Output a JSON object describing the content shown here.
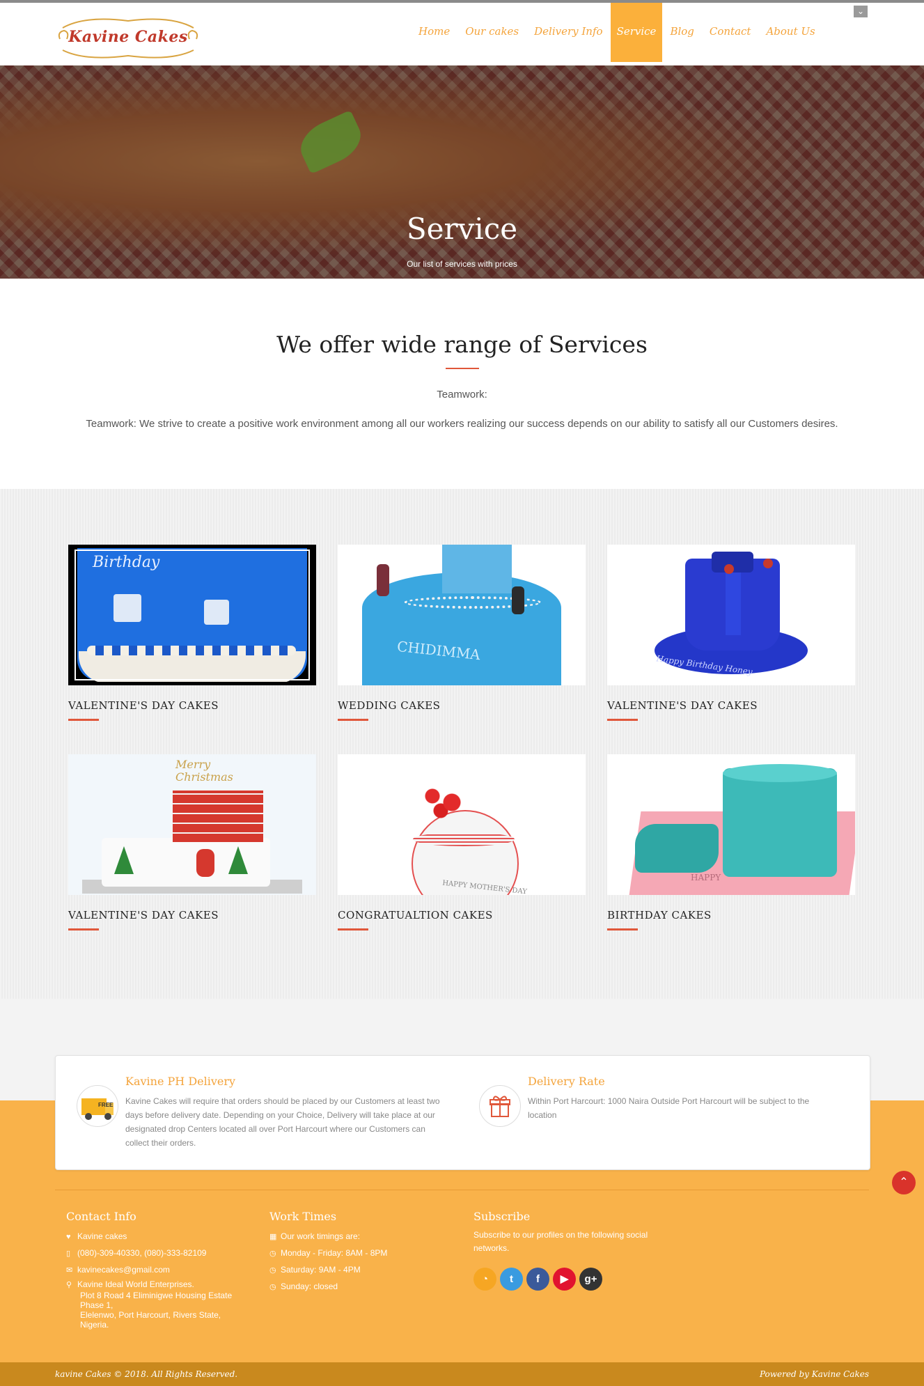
{
  "brand": {
    "logo_text": "Kavine Cakes"
  },
  "nav": {
    "items": [
      {
        "label": "Home"
      },
      {
        "label": "Our cakes"
      },
      {
        "label": "Delivery Info"
      },
      {
        "label": "Service"
      },
      {
        "label": "Blog"
      },
      {
        "label": "Contact"
      },
      {
        "label": "About Us"
      }
    ],
    "active": "Service"
  },
  "hero": {
    "title": "Service",
    "subtitle": "Our list of services with prices"
  },
  "intro": {
    "title": "We offer wide range of Services",
    "label": "Teamwork:",
    "text": "Teamwork: We strive to create a positive work environment among all our workers realizing our success depends on our ability to satisfy all our Customers desires."
  },
  "services": [
    {
      "caption": "Valentine's Day Cakes",
      "image_text": "Birthday"
    },
    {
      "caption": "Wedding Cakes",
      "image_text": "CHIDIMMA"
    },
    {
      "caption": "Valentine's Day Cakes",
      "image_text": "Happy Birthday Honey"
    },
    {
      "caption": "Valentine's Day Cakes",
      "image_text": "Merry Christmas"
    },
    {
      "caption": "CONGRATUALTION CAKES",
      "image_text": "HAPPY MOTHER'S DAY"
    },
    {
      "caption": "Birthday Cakes",
      "image_text": "HAPPY"
    }
  ],
  "info": {
    "delivery": {
      "title": "Kavine PH Delivery",
      "text": "Kavine Cakes will require that orders should be placed by our Customers at least two days before delivery date. Depending on your Choice, Delivery will take place at our designated drop Centers located all over Port Harcourt where our Customers can collect their orders.",
      "icon_label": "FREE"
    },
    "rate": {
      "title": "Delivery Rate",
      "text": "Within Port Harcourt: 1000 Naira Outside Port Harcourt will be subject to the location"
    }
  },
  "footer": {
    "contact": {
      "title": "Contact Info",
      "name": "Kavine cakes",
      "phone": "(080)-309-40330, (080)-333-82109",
      "email": "kavinecakes@gmail.com",
      "address": [
        "Kavine Ideal World Enterprises.",
        "Plot 8 Road 4 Eliminigwe Housing Estate",
        "Phase 1,",
        "Elelenwo, Port Harcourt, Rivers State,",
        "Nigeria."
      ]
    },
    "worktimes": {
      "title": "Work Times",
      "intro": "Our work timings are:",
      "weekday": "Monday - Friday: 8AM - 8PM",
      "saturday": "Saturday: 9AM - 4PM",
      "sunday": "Sunday: closed"
    },
    "subscribe": {
      "title": "Subscribe",
      "text": "Subscribe to our profiles on the following social networks.",
      "networks": [
        {
          "name": "rss-icon",
          "color": "#f6a623",
          "glyph": "◔"
        },
        {
          "name": "twitter-icon",
          "color": "#3a9be0",
          "glyph": "t"
        },
        {
          "name": "facebook-icon",
          "color": "#3b5a9a",
          "glyph": "f"
        },
        {
          "name": "youtube-icon",
          "color": "#e1132f",
          "glyph": "▶"
        },
        {
          "name": "google-plus-icon",
          "color": "#333333",
          "glyph": "g+"
        }
      ]
    },
    "copyright": "kavine Cakes © 2018. All Rights Reserved.",
    "powered": "Powered by Kavine Cakes"
  },
  "colors": {
    "accent": "#f4a43c",
    "nav_active_bg": "#fbb03b",
    "rule": "#e0573a",
    "footer_bg": "#f9b24a"
  }
}
